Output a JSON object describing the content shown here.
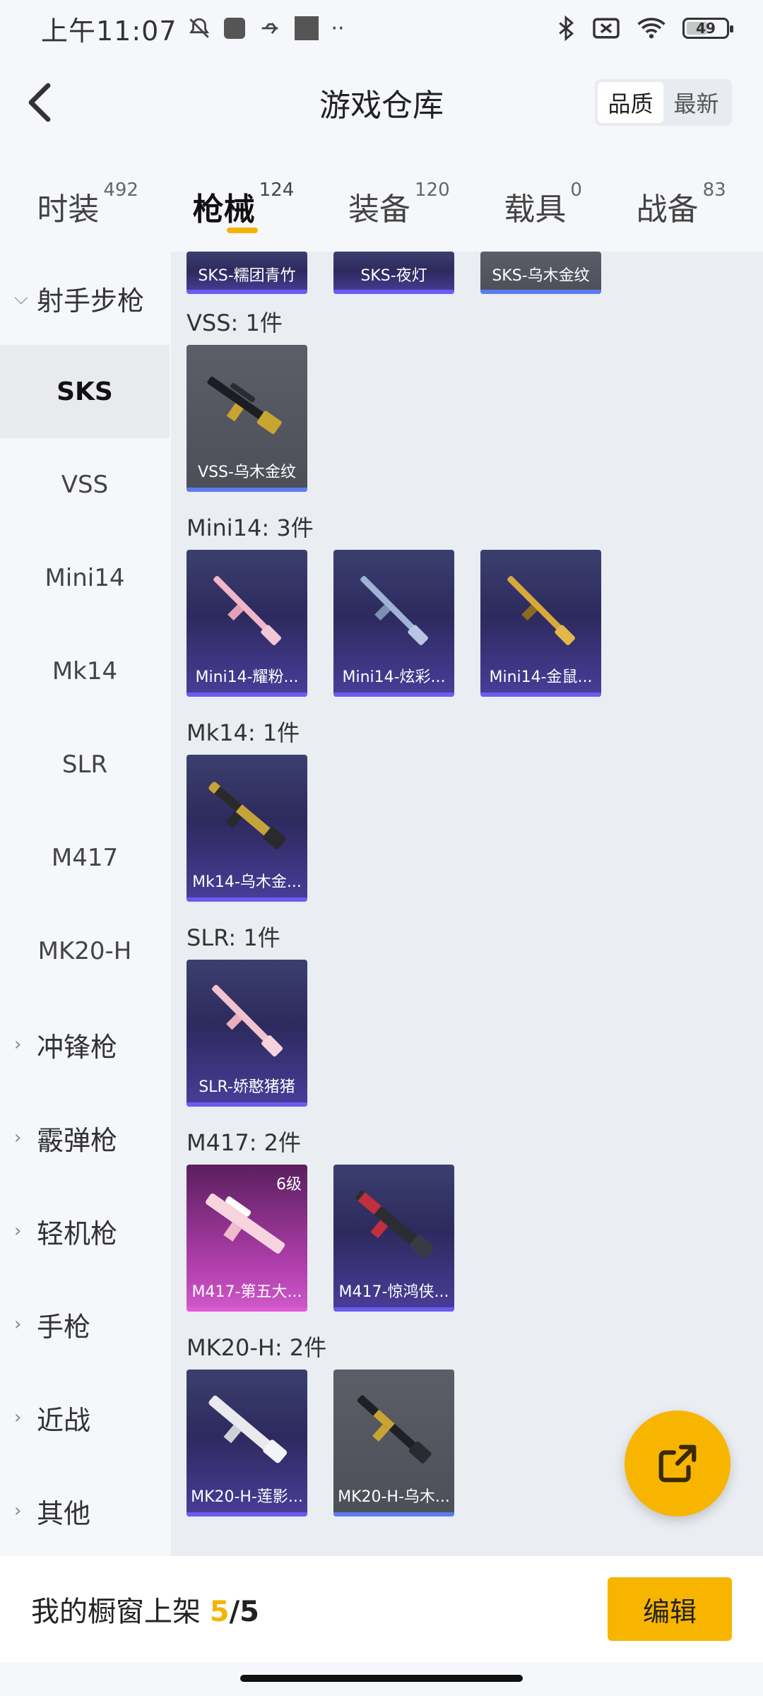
{
  "status_bar": {
    "time": "上午11:07",
    "battery": "49",
    "icons": [
      "bell-off-icon",
      "app-icon",
      "usb-icon",
      "app-icon",
      "more-icon",
      "bluetooth-icon",
      "no-sim-icon",
      "wifi-icon",
      "battery-icon"
    ]
  },
  "header": {
    "title": "游戏仓库",
    "sort_quality": "品质",
    "sort_latest": "最新"
  },
  "tabs": [
    {
      "label": "时装",
      "count": "492"
    },
    {
      "label": "枪械",
      "count": "124"
    },
    {
      "label": "装备",
      "count": "120"
    },
    {
      "label": "载具",
      "count": "0"
    },
    {
      "label": "战备",
      "count": "83"
    }
  ],
  "sidebar": {
    "top_category": "射手步枪",
    "sub_items": [
      "SKS",
      "VSS",
      "Mini14",
      "Mk14",
      "SLR",
      "M417",
      "MK20-H"
    ],
    "categories": [
      "冲锋枪",
      "霰弹枪",
      "轻机枪",
      "手枪",
      "近战",
      "其他"
    ]
  },
  "content": {
    "top_partial": [
      "SKS-糯团青竹",
      "SKS-夜灯",
      "SKS-乌木金纹"
    ],
    "groups": [
      {
        "label": "VSS: 1件",
        "items": [
          {
            "name": "VSS-乌木金纹",
            "level": ""
          }
        ]
      },
      {
        "label": "Mini14: 3件",
        "items": [
          {
            "name": "Mini14-耀粉...",
            "level": ""
          },
          {
            "name": "Mini14-炫彩...",
            "level": ""
          },
          {
            "name": "Mini14-金鼠...",
            "level": ""
          }
        ]
      },
      {
        "label": "Mk14: 1件",
        "items": [
          {
            "name": "Mk14-乌木金...",
            "level": ""
          }
        ]
      },
      {
        "label": "SLR: 1件",
        "items": [
          {
            "name": "SLR-娇憨猪猪",
            "level": ""
          }
        ]
      },
      {
        "label": "M417: 2件",
        "items": [
          {
            "name": "M417-第五大...",
            "level": "6级"
          },
          {
            "name": "M417-惊鸿侠...",
            "level": ""
          }
        ]
      },
      {
        "label": "MK20-H: 2件",
        "items": [
          {
            "name": "MK20-H-莲影...",
            "level": ""
          },
          {
            "name": "MK20-H-乌木...",
            "level": ""
          }
        ]
      }
    ]
  },
  "bottom_bar": {
    "showcase_label": "我的橱窗上架",
    "showcase_count": "5",
    "showcase_sep": "/",
    "showcase_total": "5",
    "edit_label": "编辑"
  },
  "colors": {
    "accent": "#f7b500",
    "card_purple": "#2d2a5e",
    "card_gray": "#4c4f58",
    "card_pink": "#b23fae"
  }
}
